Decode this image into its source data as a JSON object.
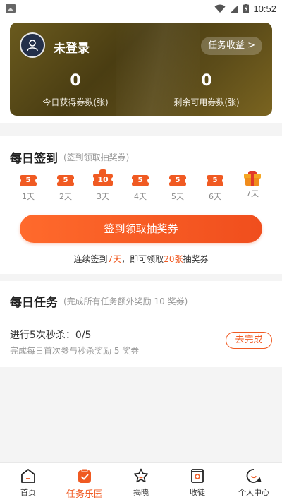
{
  "status_bar": {
    "time": "10:52"
  },
  "header": {
    "login_text": "未登录",
    "earnings_button": "任务收益 >",
    "stats": [
      {
        "value": "0",
        "label": "今日获得券数(张)"
      },
      {
        "value": "0",
        "label": "剩余可用券数(张)"
      }
    ]
  },
  "checkin": {
    "title": "每日签到",
    "subtitle": "(签到领取抽奖券)",
    "days": [
      {
        "reward": "5",
        "label": "1天"
      },
      {
        "reward": "5",
        "label": "2天"
      },
      {
        "reward": "10",
        "label": "3天"
      },
      {
        "reward": "5",
        "label": "4天"
      },
      {
        "reward": "5",
        "label": "5天"
      },
      {
        "reward": "5",
        "label": "6天"
      },
      {
        "reward": "",
        "label": "7天"
      }
    ],
    "button": "签到领取抽奖券",
    "hint": {
      "prefix": "连续签到",
      "days": "7天",
      "middle": "，即可领取",
      "count": "20张",
      "suffix": "抽奖券"
    }
  },
  "tasks": {
    "title": "每日任务",
    "subtitle": "(完成所有任务额外奖励 10 奖券)",
    "items": [
      {
        "name": "进行5次秒杀：0/5",
        "desc": "完成每日首次参与秒杀奖励 5 奖券",
        "button": "去完成"
      }
    ]
  },
  "nav": {
    "items": [
      {
        "label": "首页"
      },
      {
        "label": "任务乐园"
      },
      {
        "label": "揭晓"
      },
      {
        "label": "收徒"
      },
      {
        "label": "个人中心"
      }
    ]
  },
  "colors": {
    "accent": "#f05a22",
    "card_gold": "#5c4c19"
  }
}
